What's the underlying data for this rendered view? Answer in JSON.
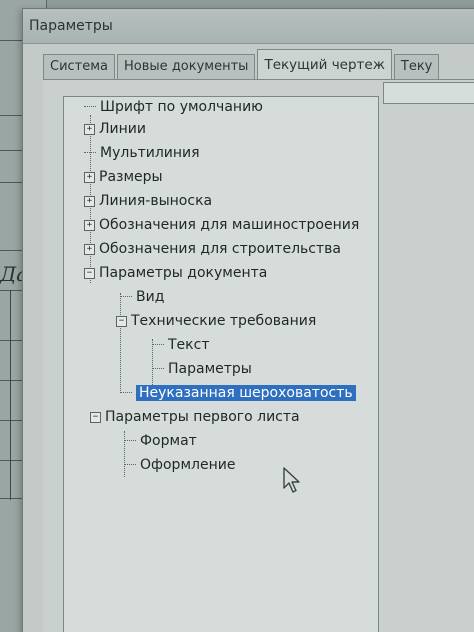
{
  "window": {
    "title": "Параметры"
  },
  "tabs": [
    {
      "label": "Система",
      "active": false
    },
    {
      "label": "Новые документы",
      "active": false
    },
    {
      "label": "Текущий чертеж",
      "active": true
    },
    {
      "label": "Теку",
      "active": false
    }
  ],
  "background_app": {
    "italic_label": "Дат"
  },
  "tree": [
    {
      "label": "Шрифт по умолчанию",
      "expander": ""
    },
    {
      "label": "Линии",
      "expander": "+"
    },
    {
      "label": "Мультилиния",
      "expander": ""
    },
    {
      "label": "Размеры",
      "expander": "+"
    },
    {
      "label": "Линия-выноска",
      "expander": "+"
    },
    {
      "label": "Обозначения для машиностроения",
      "expander": "+"
    },
    {
      "label": "Обозначения для строительства",
      "expander": "+"
    },
    {
      "label": "Параметры документа",
      "expander": "−"
    },
    {
      "label": "Вид",
      "expander": ""
    },
    {
      "label": "Технические требования",
      "expander": "−"
    },
    {
      "label": "Текст",
      "expander": ""
    },
    {
      "label": "Параметры",
      "expander": ""
    },
    {
      "label": "Неуказанная шероховатость",
      "expander": "",
      "selected": true
    },
    {
      "label": "Параметры первого листа",
      "expander": "−"
    },
    {
      "label": "Формат",
      "expander": ""
    },
    {
      "label": "Оформление",
      "expander": ""
    }
  ],
  "colors": {
    "selection": "#2f6fc0"
  }
}
